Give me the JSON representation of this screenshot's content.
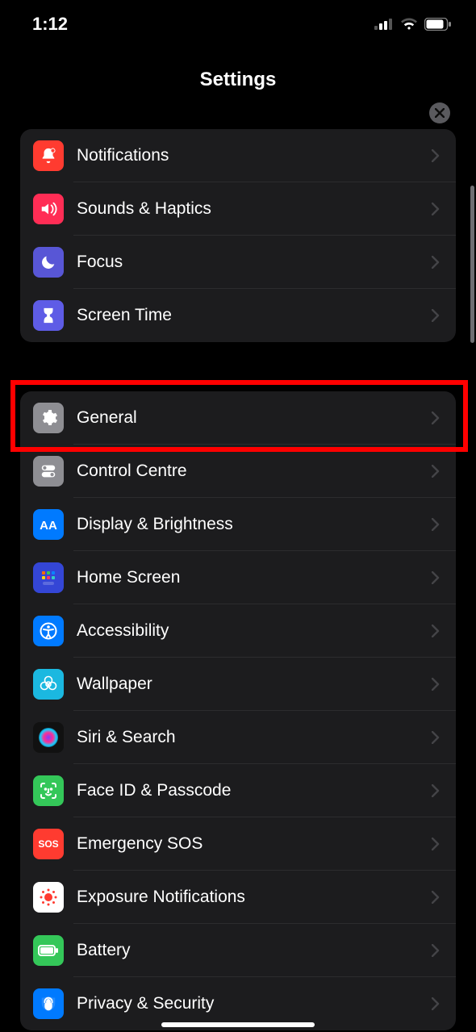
{
  "status": {
    "time": "1:12"
  },
  "header": {
    "title": "Settings"
  },
  "group1": [
    {
      "key": "notifications",
      "label": "Notifications"
    },
    {
      "key": "sounds",
      "label": "Sounds & Haptics"
    },
    {
      "key": "focus",
      "label": "Focus"
    },
    {
      "key": "screentime",
      "label": "Screen Time"
    }
  ],
  "group2": [
    {
      "key": "general",
      "label": "General"
    },
    {
      "key": "controlcentre",
      "label": "Control Centre"
    },
    {
      "key": "display",
      "label": "Display & Brightness"
    },
    {
      "key": "homescreen",
      "label": "Home Screen"
    },
    {
      "key": "accessibility",
      "label": "Accessibility"
    },
    {
      "key": "wallpaper",
      "label": "Wallpaper"
    },
    {
      "key": "siri",
      "label": "Siri & Search"
    },
    {
      "key": "faceid",
      "label": "Face ID & Passcode"
    },
    {
      "key": "sos",
      "label": "Emergency SOS"
    },
    {
      "key": "exposure",
      "label": "Exposure Notifications"
    },
    {
      "key": "battery",
      "label": "Battery"
    },
    {
      "key": "privacy",
      "label": "Privacy & Security"
    }
  ],
  "highlighted_row": "general"
}
